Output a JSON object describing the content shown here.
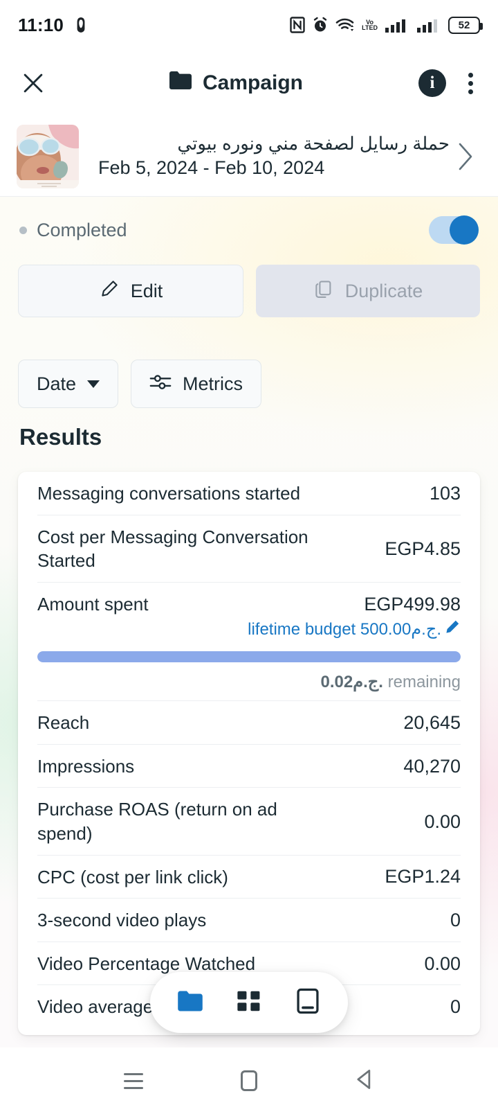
{
  "statusbar": {
    "time": "11:10",
    "battery_level": "52",
    "icons": [
      "nfc-icon",
      "alarm-icon",
      "wifi-icon",
      "volte-icon",
      "signal-icon-1",
      "signal-icon-2",
      "battery-icon"
    ],
    "volte_top": "Vo",
    "volte_bottom": "LTED"
  },
  "appbar": {
    "title": "Campaign",
    "close_label": "✕",
    "info_label": "i"
  },
  "campaign": {
    "name": "حملة رسايل لصفحة مني ونوره بيوتي",
    "dates": "Feb 5, 2024 - Feb 10, 2024"
  },
  "status": {
    "label": "Completed",
    "toggle_on": true
  },
  "actions": {
    "edit_label": "Edit",
    "duplicate_label": "Duplicate"
  },
  "filters": {
    "date_label": "Date",
    "metrics_label": "Metrics"
  },
  "results": {
    "heading": "Results",
    "rows": [
      {
        "label": "Messaging conversations started",
        "value": "103"
      },
      {
        "label": "Cost per Messaging Conversation Started",
        "value": "EGP4.85"
      },
      {
        "label": "Amount spent",
        "value": "EGP499.98"
      }
    ],
    "budget": {
      "link_text": "lifetime budget 500.00ج.م.",
      "edit_icon": "pencil-icon",
      "progress_percent": 100,
      "remaining_amount": "0.02ج.م.",
      "remaining_suffix": "remaining"
    },
    "rows2": [
      {
        "label": "Reach",
        "value": "20,645"
      },
      {
        "label": "Impressions",
        "value": "40,270"
      },
      {
        "label": "Purchase ROAS (return on ad spend)",
        "value": "0.00"
      },
      {
        "label": "CPC (cost per link click)",
        "value": "EGP1.24"
      },
      {
        "label": "3-second video plays",
        "value": "0"
      },
      {
        "label": "Video Percentage Watched",
        "value": "0.00"
      },
      {
        "label": "Video average play time",
        "value": "0"
      }
    ]
  },
  "bottom_nav": {
    "items": [
      {
        "icon": "folder-icon",
        "name": "campaigns",
        "active": true
      },
      {
        "icon": "grid-icon",
        "name": "ad-sets",
        "active": false
      },
      {
        "icon": "ad-icon",
        "name": "ads",
        "active": false
      }
    ]
  },
  "android_nav": {
    "items": [
      "recents-button",
      "home-button",
      "back-button"
    ]
  },
  "colors": {
    "accent_blue": "#1877c4",
    "progress_blue": "#8ba9ea",
    "link_blue": "#1877c4",
    "text_dark": "#1c2b33",
    "text_muted": "#8d979e"
  }
}
